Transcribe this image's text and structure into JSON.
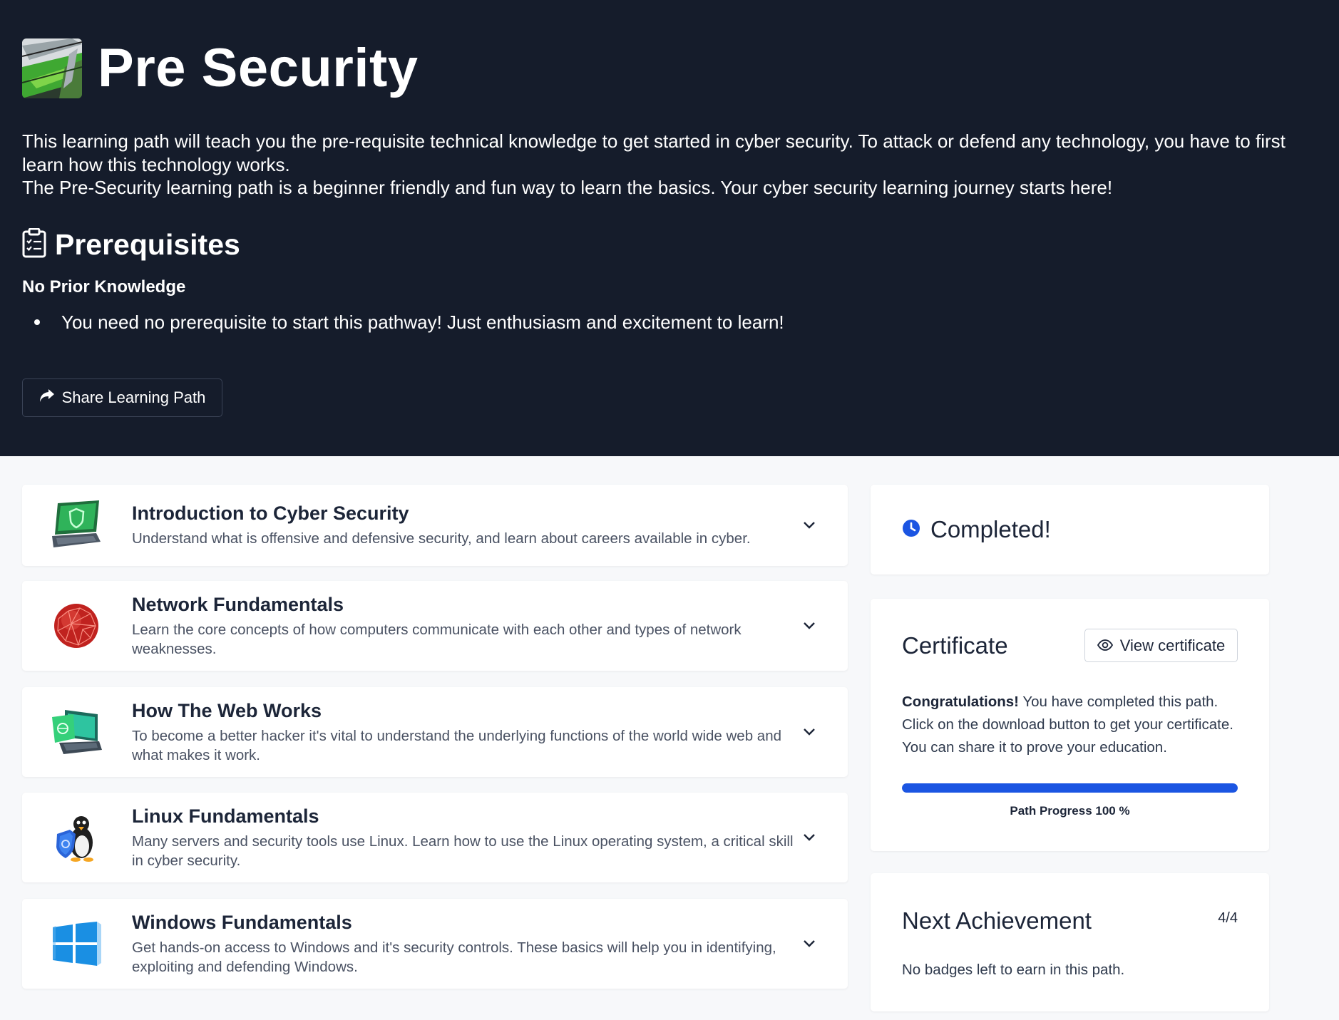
{
  "path": {
    "title": "Pre Security",
    "description_1": "This learning path will teach you the pre-requisite technical knowledge to get started in cyber security. To attack or defend any technology, you have to first learn how this technology works.",
    "description_2": "The Pre-Security learning path is a beginner friendly and fun way to learn the basics. Your cyber security learning journey starts here!"
  },
  "prerequisites": {
    "heading": "Prerequisites",
    "subheading": "No Prior Knowledge",
    "items": [
      "You need no prerequisite to start this pathway! Just enthusiasm and excitement to learn!"
    ]
  },
  "share_button": {
    "label": "Share Learning Path",
    "icon": "share-icon"
  },
  "modules": [
    {
      "title": "Introduction to Cyber Security",
      "description": "Understand what is offensive and defensive security, and learn about careers available in cyber.",
      "icon": "laptop-shield-icon"
    },
    {
      "title": "Network Fundamentals",
      "description": "Learn the core concepts of how computers communicate with each other and types of network weaknesses.",
      "icon": "network-globe-icon"
    },
    {
      "title": "How The Web Works",
      "description": "To become a better hacker it's vital to understand the underlying functions of the world wide web and what makes it work.",
      "icon": "laptop-web-icon"
    },
    {
      "title": "Linux Fundamentals",
      "description": "Many servers and security tools use Linux. Learn how to use the Linux operating system, a critical skill in cyber security.",
      "icon": "linux-penguin-icon"
    },
    {
      "title": "Windows Fundamentals",
      "description": "Get hands-on access to Windows and it's security controls. These basics will help you in identifying, exploiting and defending Windows.",
      "icon": "windows-logo-icon"
    }
  ],
  "status": {
    "label": "Completed!",
    "icon": "clock-icon",
    "color": "#1b55e2"
  },
  "certificate": {
    "title": "Certificate",
    "view_label": "View certificate",
    "congrats": "Congratulations!",
    "message": " You have completed this path. Click on the download button to get your certificate. You can share it to prove your education.",
    "progress_percent": 100,
    "progress_label": "Path Progress 100 %"
  },
  "achievement": {
    "title": "Next Achievement",
    "count": "4/4",
    "message": "No badges left to earn in this path."
  },
  "colors": {
    "hero_bg": "#151c2b",
    "accent": "#1b55e2",
    "page_bg": "#f7f8fa"
  }
}
